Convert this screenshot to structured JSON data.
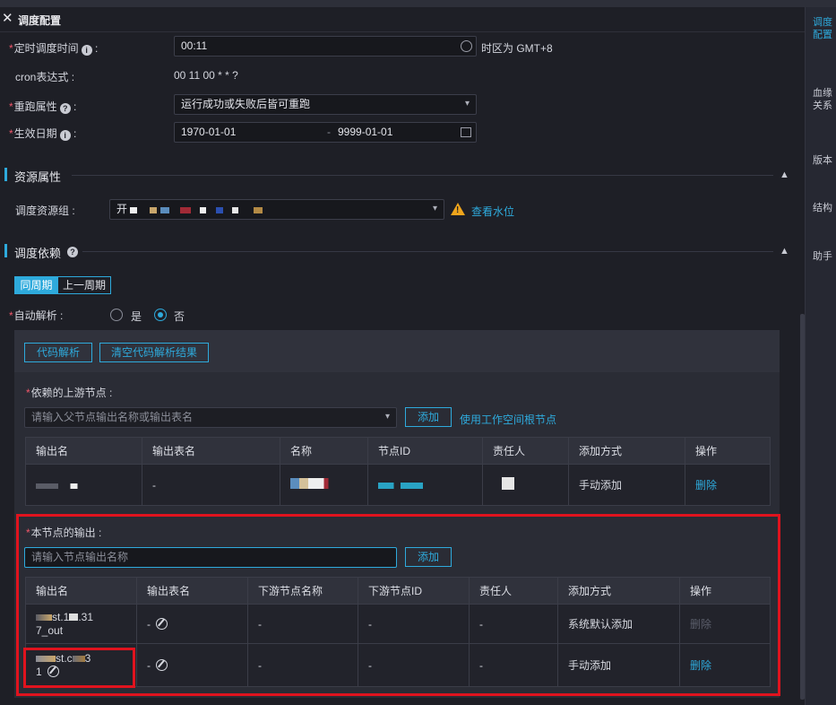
{
  "panel": {
    "title": "调度配置"
  },
  "schedule": {
    "time_label": "定时调度时间",
    "time_value": "00:11",
    "timezone": "时区为 GMT+8",
    "cron_label": "cron表达式",
    "cron_value": "00 11 00 * * ?",
    "rerun_label": "重跑属性",
    "rerun_value": "运行成功或失败后皆可重跑",
    "effective_label": "生效日期",
    "effective_start": "1970-01-01",
    "effective_sep": "-",
    "effective_end": "9999-01-01"
  },
  "resource": {
    "section_title": "资源属性",
    "group_label": "调度资源组",
    "group_value_prefix": "开",
    "watermark_link": "查看水位"
  },
  "dependency": {
    "section_title": "调度依赖",
    "tab_same_cycle": "同周期",
    "tab_prev_cycle": "上一周期",
    "auto_parse_label": "自动解析",
    "auto_parse_yes": "是",
    "auto_parse_no": "否",
    "auto_parse_selected": "否",
    "code_parse_button": "代码解析",
    "clear_parse_button": "清空代码解析结果",
    "upstream_label": "依赖的上游节点",
    "upstream_placeholder": "请输入父节点输出名称或输出表名",
    "upstream_add_button": "添加",
    "use_root_link": "使用工作空间根节点",
    "upstream_columns": [
      "输出名",
      "输出表名",
      "名称",
      "节点ID",
      "责任人",
      "添加方式",
      "操作"
    ],
    "upstream_rows": [
      {
        "output_name": "",
        "table_name": "-",
        "name": "",
        "node_id": "",
        "owner": "",
        "add_method": "手动添加",
        "action": "删除"
      }
    ],
    "output_label": "本节点的输出",
    "output_placeholder": "请输入节点输出名称",
    "output_add_button": "添加",
    "output_columns": [
      "输出名",
      "输出表名",
      "下游节点名称",
      "下游节点ID",
      "责任人",
      "添加方式",
      "操作"
    ],
    "output_rows": [
      {
        "output_name_a": "st.1",
        "output_name_b": ".31",
        "output_name_c": "7_out",
        "table_name": "-",
        "down_name": "-",
        "down_id": "-",
        "owner": "-",
        "add_method": "系统默认添加",
        "action": "删除",
        "action_enabled": false
      },
      {
        "output_name_a": "st.c",
        "output_name_b": "3",
        "output_name_c": "1",
        "table_name": "-",
        "down_name": "-",
        "down_id": "-",
        "owner": "-",
        "add_method": "手动添加",
        "action": "删除",
        "action_enabled": true
      }
    ]
  },
  "right_nav": {
    "items": [
      "调度配置",
      "血缘关系",
      "版本",
      "结构",
      "助手"
    ],
    "active": "调度配置"
  },
  "colors": {
    "accent": "#2eaadc",
    "required": "#f0566a",
    "highlight": "#e0131e",
    "warning": "#f0a51c"
  }
}
